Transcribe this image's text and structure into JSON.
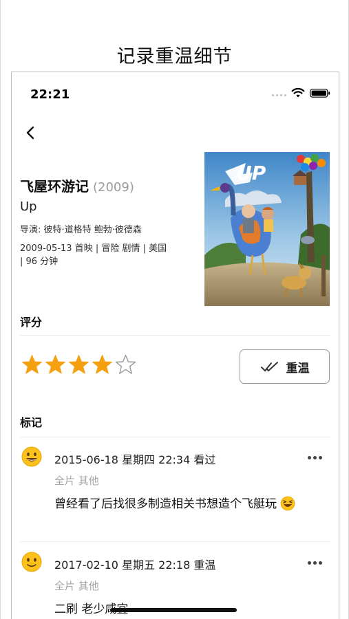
{
  "page_caption": "记录重温细节",
  "status_bar": {
    "time": "22:21"
  },
  "movie": {
    "title": "飞屋环游记",
    "year": "(2009)",
    "english_title": "Up",
    "director_label": "导演:",
    "directors": "彼特·道格特  鲍勃·彼德森",
    "meta_line_1": "2009-05-13 首映 | 冒险 剧情 | 美国",
    "meta_line_2": "| 96 分钟",
    "poster_text": "UP"
  },
  "rating": {
    "section_title": "评分",
    "stars_filled": 4,
    "stars_total": 5,
    "rewatch_label": "重温"
  },
  "records": {
    "section_title": "标记",
    "items": [
      {
        "emoji": "smiling-face-icon",
        "title": "2015-06-18 星期四 22:34  看过",
        "tags": "全片 其他",
        "note": "曾经看了后找很多制造相关书想造个飞艇玩",
        "note_emoji": "laughing-face-icon"
      },
      {
        "emoji": "slightly-smiling-face-icon",
        "title": "2017-02-10 星期五 22:18  重温",
        "tags": "全片 其他",
        "note": "二刷 老少咸宜"
      }
    ]
  },
  "colors": {
    "star": "#f5a010",
    "accent_text": "#222222",
    "muted_text": "#a6a6a6"
  }
}
